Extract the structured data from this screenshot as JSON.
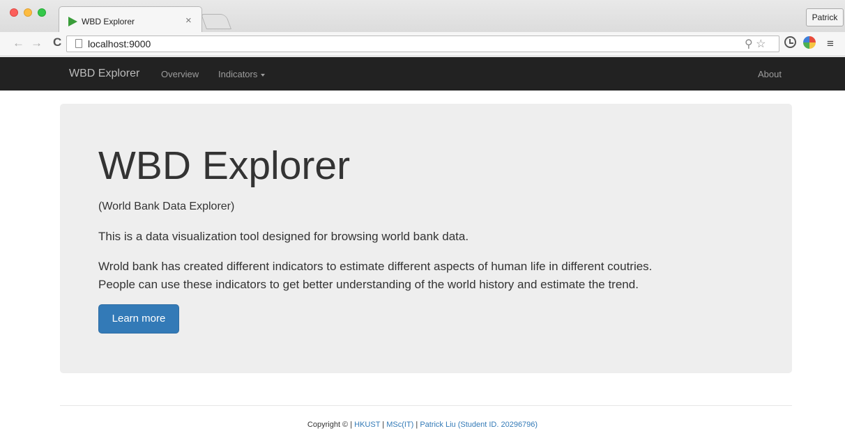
{
  "browser": {
    "tab_title": "WBD Explorer",
    "tab_close": "×",
    "profile": "Patrick",
    "url": "localhost:9000",
    "back": "←",
    "forward": "→",
    "reload": "C",
    "omni_icons": "⚲ ☆",
    "menu": "≡"
  },
  "navbar": {
    "brand": "WBD Explorer",
    "links": [
      "Overview",
      "Indicators",
      "About"
    ]
  },
  "jumbotron": {
    "title": "WBD Explorer",
    "subtitle": "(World Bank Data Explorer)",
    "paragraph1": "This is a data visualization tool designed for browsing world bank data.",
    "paragraph2_line1": "Wrold bank has created different indicators to estimate different aspects of human life in different coutries.",
    "paragraph2_line2": "People can use these indicators to get better understanding of the world history and estimate the trend.",
    "button": "Learn more"
  },
  "footer": {
    "copyright": "Copyright © | ",
    "links": [
      "HKUST",
      "MSc(IT)",
      "Patrick Liu (Student ID. 20296796)"
    ],
    "sep": " | "
  }
}
